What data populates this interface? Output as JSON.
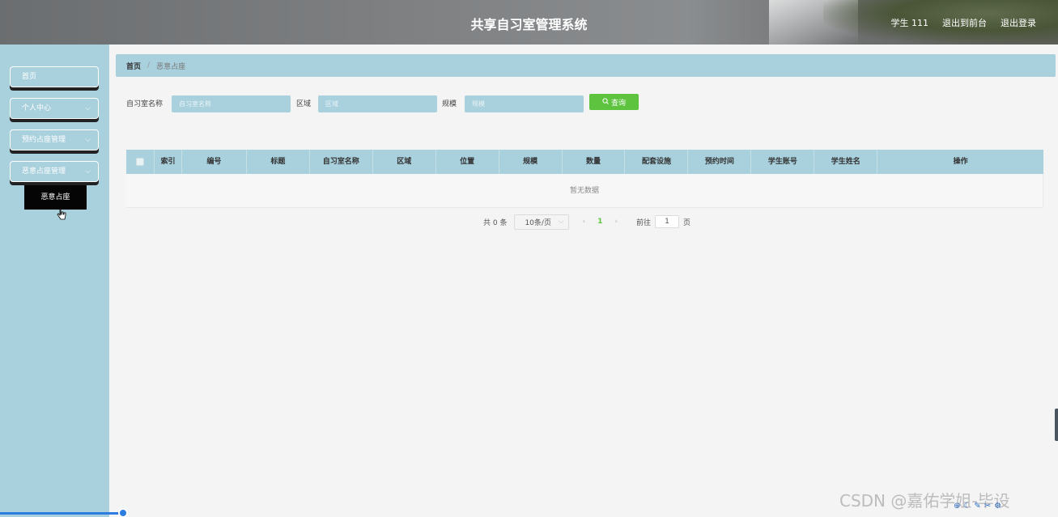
{
  "header": {
    "title": "共享自习室管理系统",
    "nav": [
      "学生 111",
      "退出到前台",
      "退出登录"
    ]
  },
  "sidebar": {
    "items": [
      {
        "label": "首页",
        "has_children": false
      },
      {
        "label": "个人中心",
        "has_children": true
      },
      {
        "label": "预约占座管理",
        "has_children": true
      },
      {
        "label": "恶意占座管理",
        "has_children": true
      }
    ],
    "popup": "恶意占座"
  },
  "breadcrumb": {
    "home": "首页",
    "current": "恶意占座"
  },
  "search": {
    "fields": [
      {
        "label": "自习室名称",
        "placeholder": "自习室名称"
      },
      {
        "label": "区域",
        "placeholder": "区域"
      },
      {
        "label": "规模",
        "placeholder": "规模"
      }
    ],
    "query_label": "查询"
  },
  "table": {
    "columns": [
      "索引",
      "编号",
      "标题",
      "自习室名称",
      "区域",
      "位置",
      "规模",
      "数量",
      "配套设施",
      "预约时间",
      "学生账号",
      "学生姓名",
      "操作"
    ],
    "empty_text": "暂无数据"
  },
  "pagination": {
    "total": "共 0 条",
    "page_size": "10条/页",
    "current_page": "1",
    "goto_label": "前往",
    "goto_value": "1",
    "page_unit": "页"
  },
  "watermark": "CSDN @嘉佑学姐-毕设",
  "colors": {
    "accent": "#a9d0dd",
    "button": "#5ec33f",
    "popup": "#050505"
  }
}
